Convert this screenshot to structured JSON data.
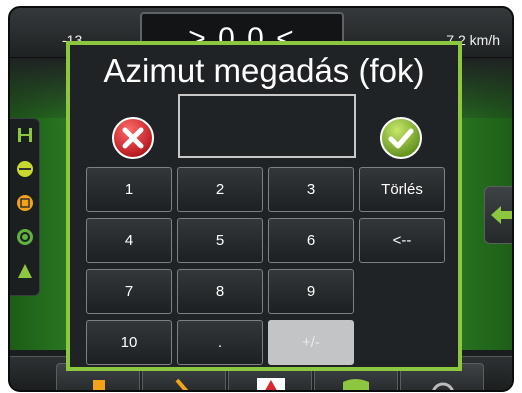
{
  "top_bar": {
    "left_readout": "-13",
    "center_readout": "> 0.0 <",
    "speed_readout": "7.2 km/h"
  },
  "dialog": {
    "title": "Azimut megadás (fok)",
    "cancel_icon": "x-circle-icon",
    "confirm_icon": "check-circle-icon",
    "value": "",
    "keys": {
      "k1": "1",
      "k2": "2",
      "k3": "3",
      "clear": "Törlés",
      "k4": "4",
      "k5": "5",
      "k6": "6",
      "backspace": "<--",
      "k7": "7",
      "k8": "8",
      "k9": "9",
      "k10": "10",
      "dot": ".",
      "sign": "+/-"
    },
    "sign_key_enabled": false
  },
  "colors": {
    "accent_green": "#8dc63f",
    "cancel_red": "#d9262c",
    "field_green": "#2c7e24"
  },
  "left_toolbar_icons": [
    "straight-ab-line-icon",
    "ab-line-icon",
    "boundary-icon",
    "steering-icon",
    "coverage-icon"
  ],
  "right_button_icon": "left-arrow-icon",
  "bottom_bar_icons": [
    "field-icon",
    "tools-icon",
    "guidance-icon",
    "map-icon",
    "gauge-icon"
  ]
}
